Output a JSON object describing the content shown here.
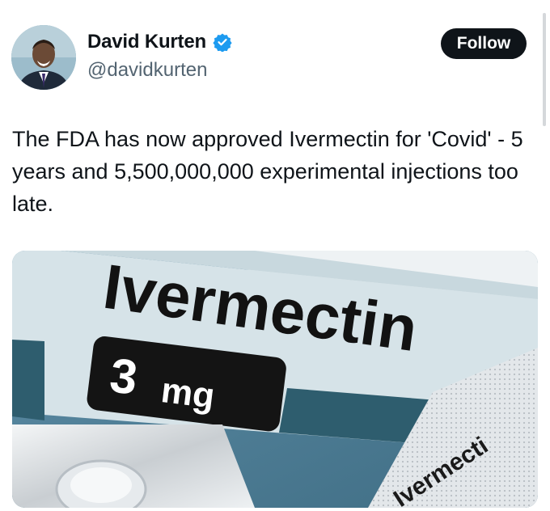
{
  "author": {
    "display_name": "David Kurten",
    "handle": "@davidkurten",
    "verified": true,
    "avatar_icon": "user-photo"
  },
  "actions": {
    "follow_label": "Follow"
  },
  "tweet": {
    "text": "The FDA has now approved Ivermectin for 'Covid' - 5 years and 5,500,000,000 experimental injections too late."
  },
  "media": {
    "box_brand": "Ivermectin",
    "dose_value": "3",
    "dose_unit": "mg",
    "blister_text": "Ivermecti"
  },
  "colors": {
    "follow_bg": "#0f1419",
    "verified_blue": "#1d9bf0",
    "box_teal": "#2e5d6e",
    "box_light": "#d9e6ea"
  }
}
